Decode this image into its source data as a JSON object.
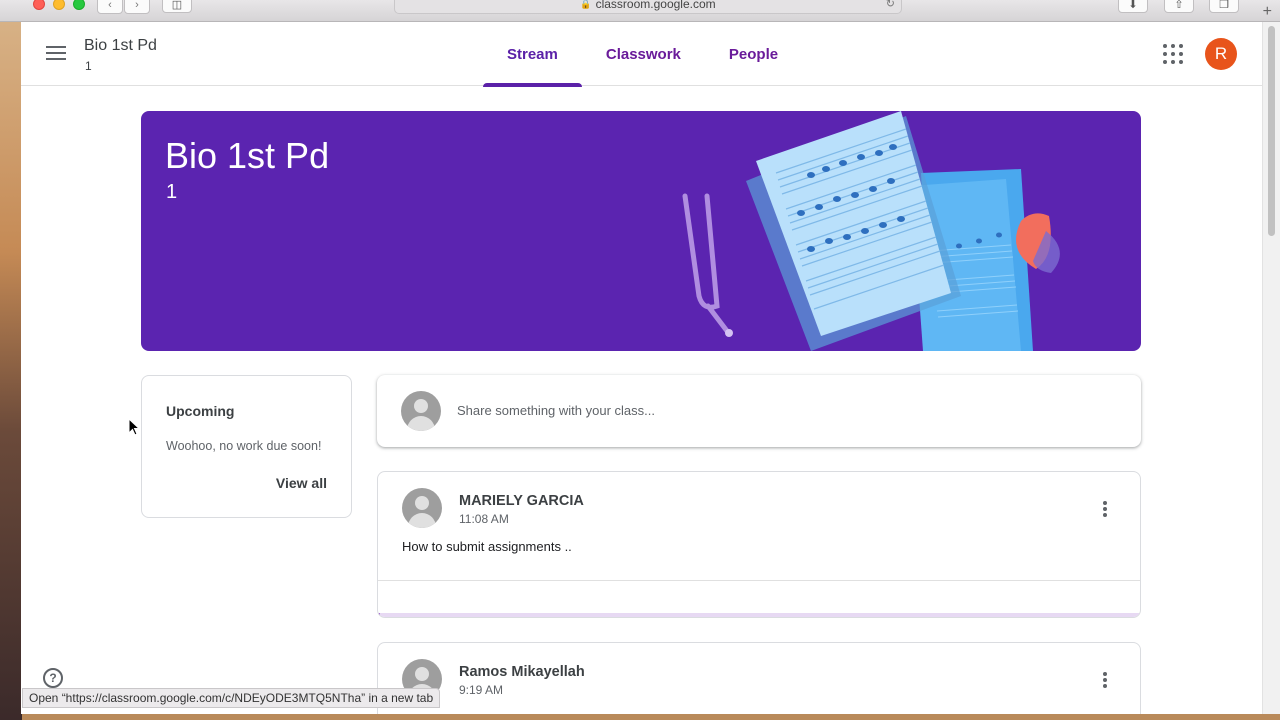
{
  "browser": {
    "url": "classroom.google.com",
    "status_link": "Open “https://classroom.google.com/c/NDEyODE3MTQ5NTha” in a new tab"
  },
  "header": {
    "class_name": "Bio 1st Pd",
    "class_section": "1",
    "tabs": [
      {
        "label": "Stream",
        "active": true
      },
      {
        "label": "Classwork",
        "active": false
      },
      {
        "label": "People",
        "active": false
      }
    ],
    "avatar_initial": "R",
    "avatar_color": "#e8541b"
  },
  "banner": {
    "title": "Bio 1st Pd",
    "section": "1",
    "color": "#5b24b0"
  },
  "upcoming": {
    "title": "Upcoming",
    "text": "Woohoo, no work due soon!",
    "view_all": "View all"
  },
  "share": {
    "placeholder": "Share something with your class..."
  },
  "posts": [
    {
      "author": "MARIELY GARCIA",
      "time": "11:08 AM",
      "body": "How to submit assignments .."
    },
    {
      "author": "Ramos Mikayellah",
      "time": "9:19 AM"
    }
  ],
  "icons": {
    "menu": "menu-icon",
    "apps": "apps-grid-icon",
    "more": "more-vert-icon",
    "help": "help-icon"
  },
  "colors": {
    "accent": "#5b21a8",
    "tab_text": "#6a1b9a"
  }
}
